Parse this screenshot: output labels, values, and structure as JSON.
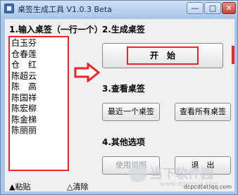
{
  "window": {
    "title": "桌签生成工具 V1.0.3 Beta",
    "minimize_glyph": "—",
    "maximize_glyph": "□",
    "close_glyph": "✕"
  },
  "input_section": {
    "label": "1.输入桌签（一行一个）",
    "lines": [
      "白玉芬",
      "仓春莲",
      "仓　红",
      "陈超云",
      "陈　高",
      "陈国祥",
      "陈宏柳",
      "陈金梯",
      "陈丽丽"
    ]
  },
  "generate_section": {
    "label": "2.生成桌签",
    "start_button": "开　始"
  },
  "view_section": {
    "label": "3.查看桌签",
    "last_button": "最近一个桌签",
    "all_button": "查看所有桌签"
  },
  "other_section": {
    "label": "4.其他选项",
    "usage_button": "使用说明",
    "exit_button": "退　出"
  },
  "bottom_links": {
    "paste": "▲粘贴",
    "clear": "△清除"
  },
  "footer": {
    "email": "dcpcd(at)qq.com"
  },
  "watermark": {
    "name": "当下软件园",
    "url": "www.downxia.com"
  },
  "colors": {
    "highlight_red": "#e8272d",
    "window_frame": "#a9c6e8",
    "client_bg": "#f0f0f0"
  },
  "icons": {
    "app": "app-icon",
    "arrow": "red-arrow-icon"
  }
}
